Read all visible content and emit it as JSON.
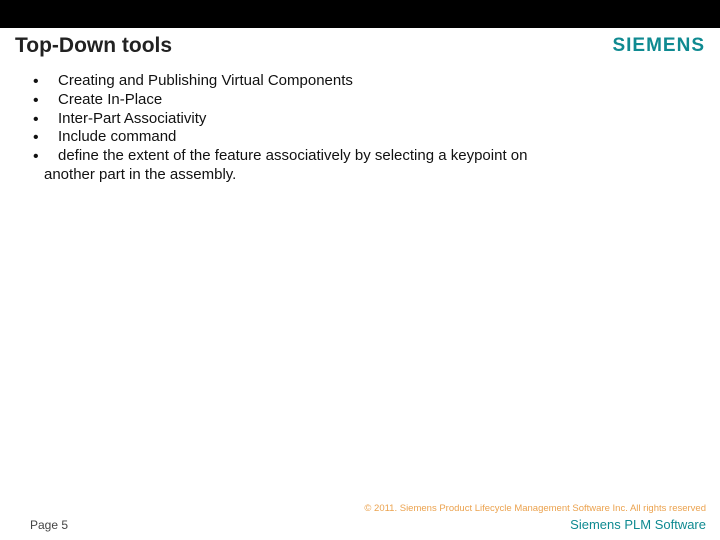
{
  "header": {
    "title": "Top-Down tools",
    "logo_text": "SIEMENS"
  },
  "bullets": [
    "Creating and Publishing Virtual Components",
    "Create In-Place",
    "Inter-Part Associativity",
    "Include command",
    "define the extent of the feature associatively by selecting a keypoint on"
  ],
  "content_wrap": "another part in the assembly.",
  "footer": {
    "copyright": "© 2011. Siemens Product Lifecycle Management Software Inc. All rights reserved",
    "page": "Page 5",
    "brand": "Siemens PLM Software"
  }
}
